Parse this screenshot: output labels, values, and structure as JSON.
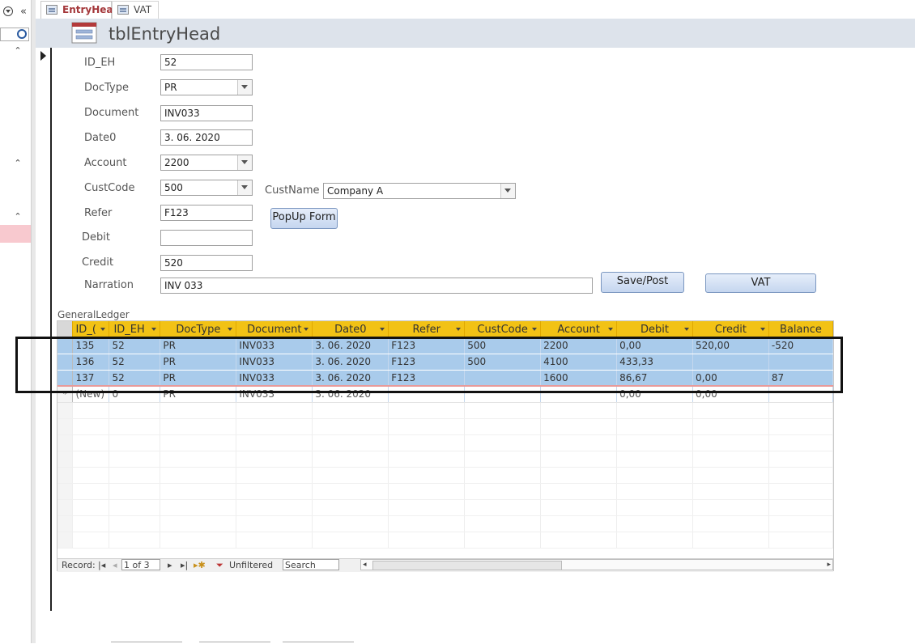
{
  "tabs": [
    {
      "label": "EntryHead",
      "active": true
    },
    {
      "label": "VAT",
      "active": false
    }
  ],
  "form_title": "tblEntryHead",
  "fields": {
    "id_eh": {
      "label": "ID_EH",
      "value": "52"
    },
    "doctype": {
      "label": "DocType",
      "value": "PR"
    },
    "document": {
      "label": "Document",
      "value": "INV033"
    },
    "date0": {
      "label": "Date0",
      "value": "3. 06. 2020"
    },
    "account": {
      "label": "Account",
      "value": "2200"
    },
    "custcode": {
      "label": "CustCode",
      "value": "500"
    },
    "custname": {
      "label": "CustName",
      "value": "Company A"
    },
    "refer": {
      "label": "Refer",
      "value": "F123"
    },
    "debit": {
      "label": "Debit",
      "value": ""
    },
    "credit": {
      "label": "Credit",
      "value": "520"
    },
    "narration": {
      "label": "Narration",
      "value": "INV 033"
    }
  },
  "buttons": {
    "popup": "PopUp Form",
    "save_post": "Save/Post",
    "vat": "VAT"
  },
  "general_ledger": {
    "label": "GeneralLedger",
    "columns": [
      "ID_(",
      "ID_EH",
      "DocType",
      "Document",
      "Date0",
      "Refer",
      "CustCode",
      "Account",
      "Debit",
      "Credit",
      "Balance"
    ],
    "rows": [
      [
        "135",
        "52",
        "PR",
        "INV033",
        "3. 06. 2020",
        "F123",
        "500",
        "2200",
        "0,00",
        "520,00",
        "-520"
      ],
      [
        "136",
        "52",
        "PR",
        "INV033",
        "3. 06. 2020",
        "F123",
        "500",
        "4100",
        "433,33",
        "",
        ""
      ],
      [
        "137",
        "52",
        "PR",
        "INV033",
        "3. 06. 2020",
        "F123",
        "",
        "1600",
        "86,67",
        "0,00",
        "87"
      ]
    ],
    "new_row": [
      "(New)",
      "0",
      "PR",
      "INV033",
      "3. 06. 2020",
      "",
      "",
      "",
      "0,00",
      "0,00",
      ""
    ]
  },
  "navigation": {
    "record_label": "Record:",
    "record_value": "1 of 3",
    "filter_label": "Unfiltered",
    "search_placeholder": "Search"
  },
  "colors": {
    "header_gold": "#f2c215",
    "selected_row": "#a9cbeb",
    "form_header_bg": "#dde3eb"
  }
}
